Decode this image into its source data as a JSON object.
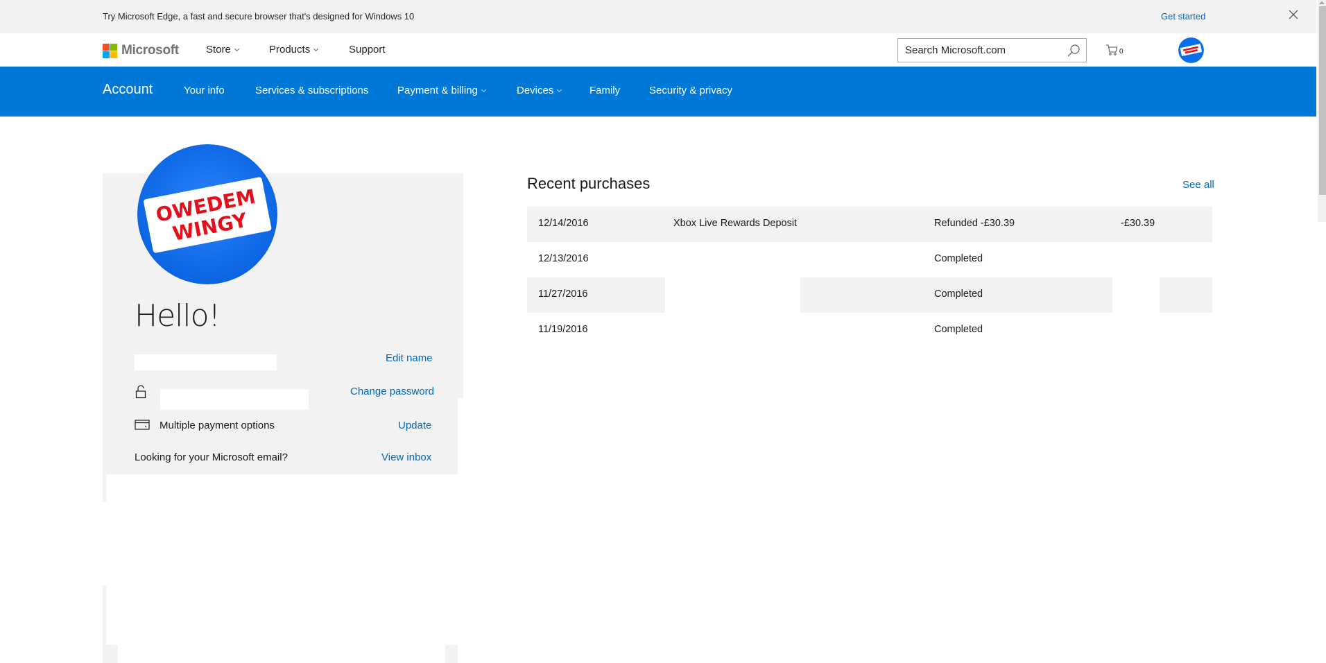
{
  "promo": {
    "text": "Try Microsoft Edge, a fast and secure browser that's designed for Windows 10",
    "cta": "Get started",
    "close_icon": "close-icon"
  },
  "header": {
    "logo_text": "Microsoft",
    "logo_colors": [
      "#f25022",
      "#7fba00",
      "#00a4ef",
      "#ffb900"
    ],
    "nav": [
      {
        "label": "Store",
        "has_dropdown": true
      },
      {
        "label": "Products",
        "has_dropdown": true
      },
      {
        "label": "Support",
        "has_dropdown": false
      }
    ],
    "search": {
      "placeholder": "Search Microsoft.com",
      "value": "",
      "icon": "search-icon"
    },
    "cart": {
      "icon": "cart-icon",
      "count": "0"
    },
    "avatar_icon": "profile-avatar"
  },
  "account_nav": {
    "title": "Account",
    "items": [
      {
        "label": "Your info",
        "has_dropdown": false
      },
      {
        "label": "Services & subscriptions",
        "has_dropdown": false
      },
      {
        "label": "Payment & billing",
        "has_dropdown": true
      },
      {
        "label": "Devices",
        "has_dropdown": true
      },
      {
        "label": "Family",
        "has_dropdown": false
      },
      {
        "label": "Security & privacy",
        "has_dropdown": false
      }
    ],
    "bg_color": "#0078d7"
  },
  "profile": {
    "greeting": "Hello!",
    "avatar_text_line1": "OWEDEM",
    "avatar_text_line2": "WINGY",
    "edit_name": "Edit name",
    "change_password": "Change password",
    "payment_text": "Multiple payment options",
    "update": "Update",
    "email_prompt": "Looking for your Microsoft email?",
    "view_inbox": "View inbox"
  },
  "recent_purchases": {
    "title": "Recent purchases",
    "see_all": "See all",
    "rows": [
      {
        "date": "12/14/2016",
        "item": "Xbox Live Rewards Deposit",
        "status": "Refunded -£30.39",
        "amount": "-£30.39"
      },
      {
        "date": "12/13/2016",
        "item": "",
        "status": "Completed",
        "amount": ""
      },
      {
        "date": "11/27/2016",
        "item": "",
        "status": "Completed",
        "amount": ""
      },
      {
        "date": "11/19/2016",
        "item": "",
        "status": "Completed",
        "amount": ""
      }
    ]
  },
  "colors": {
    "link": "#0067b8",
    "panel_bg": "#f2f2f2",
    "avatar_blue": "#0a6ee8",
    "avatar_red": "#e3101c"
  }
}
